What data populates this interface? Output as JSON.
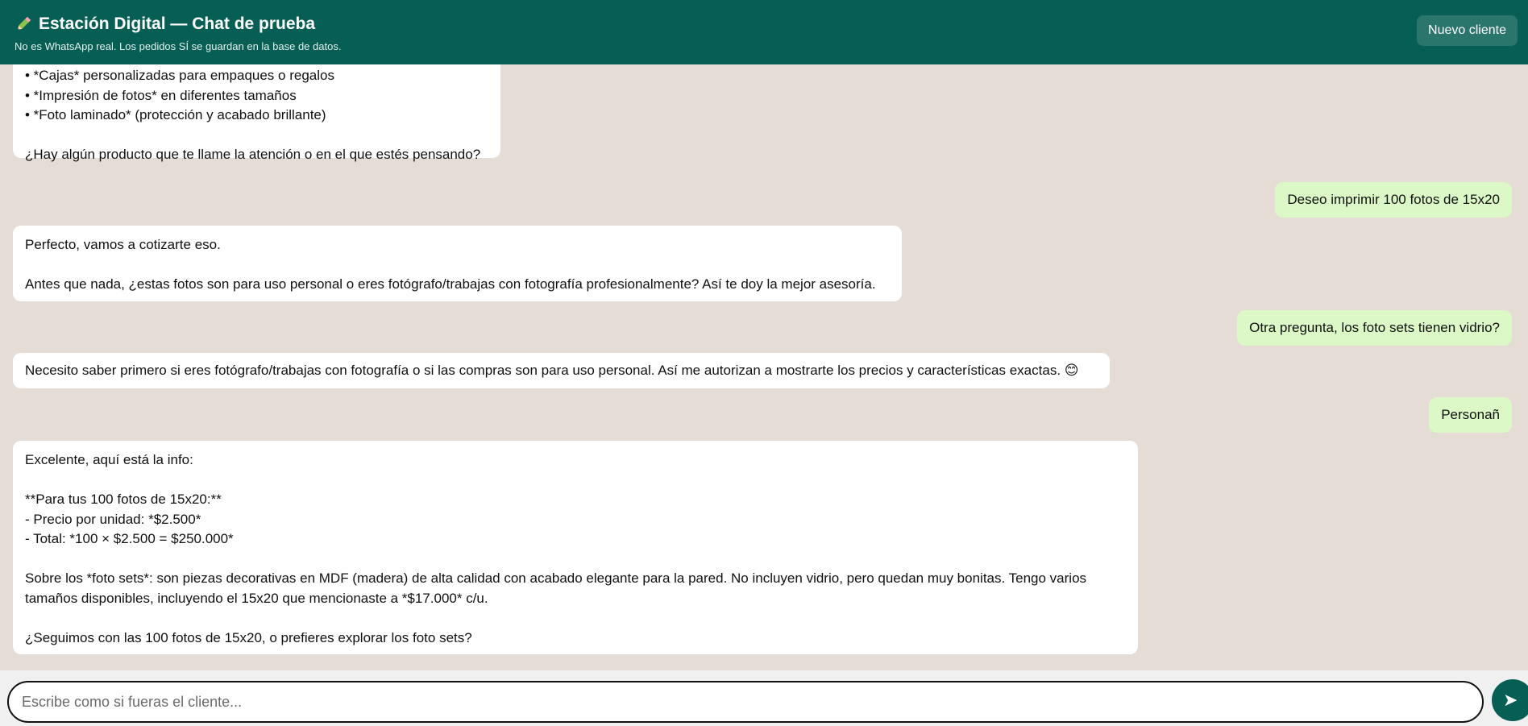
{
  "header": {
    "title": "Estación Digital — Chat de prueba",
    "subtitle": "No es WhatsApp real. Los pedidos SÍ se guardan en la base de datos.",
    "title_icon": "pencil-icon",
    "new_client_label": "Nuevo cliente"
  },
  "messages": [
    {
      "from": "bot",
      "text": "• *Cajas* personalizadas para empaques o regalos\n• *Impresión de fotos* en diferentes tamaños\n• *Foto laminado* (protección y acabado brillante)\n\n¿Hay algún producto que te llame la atención o en el que estés pensando?"
    },
    {
      "from": "me",
      "text": "Deseo imprimir 100 fotos de 15x20"
    },
    {
      "from": "bot",
      "text": "Perfecto, vamos a cotizarte eso.\n\nAntes que nada, ¿estas fotos son para uso personal o eres fotógrafo/trabajas con fotografía profesionalmente? Así te doy la mejor asesoría."
    },
    {
      "from": "me",
      "text": "Otra pregunta, los foto sets tienen vidrio?"
    },
    {
      "from": "bot",
      "text": "Necesito saber primero si eres fotógrafo/trabajas con fotografía o si las compras son para uso personal. Así me autorizan a mostrarte los precios y características exactas. 😊"
    },
    {
      "from": "me",
      "text": "Personañ"
    },
    {
      "from": "bot",
      "text": "Excelente, aquí está la info:\n\n**Para tus 100 fotos de 15x20:**\n- Precio por unidad: *$2.500*\n- Total: *100 × $2.500 = $250.000*\n\nSobre los *foto sets*: son piezas decorativas en MDF (madera) de alta calidad con acabado elegante para la pared. No incluyen vidrio, pero quedan muy bonitas. Tengo varios\ntamaños disponibles, incluyendo el 15x20 que mencionaste a *$17.000* c/u.\n\n¿Seguimos con las 100 fotos de 15x20, o prefieres explorar los foto sets?"
    }
  ],
  "composer": {
    "placeholder": "Escribe como si fueras el cliente...",
    "send_icon": "send-arrow-icon",
    "send_glyph": "➤"
  },
  "colors": {
    "header_bg": "#075e54",
    "chat_bg": "#e5ddd5",
    "outgoing_bubble": "#dcf8c6",
    "incoming_bubble": "#ffffff"
  }
}
